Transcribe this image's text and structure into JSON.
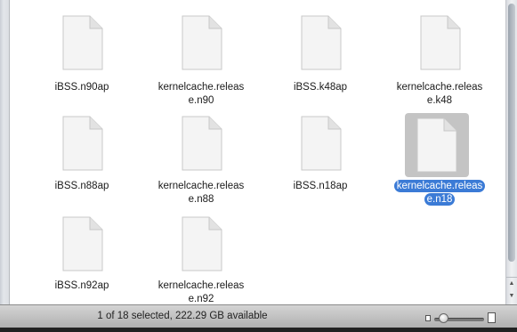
{
  "files": [
    {
      "name": "iBSS.n90ap",
      "selected": false
    },
    {
      "name": "kernelcache.releas\ne.n90",
      "selected": false
    },
    {
      "name": "iBSS.k48ap",
      "selected": false
    },
    {
      "name": "kernelcache.releas\ne.k48",
      "selected": false
    },
    {
      "name": "iBSS.n88ap",
      "selected": false
    },
    {
      "name": "kernelcache.releas\ne.n88",
      "selected": false
    },
    {
      "name": "iBSS.n18ap",
      "selected": false
    },
    {
      "name": "kernelcache.releas\ne.n18",
      "selected": true
    },
    {
      "name": "iBSS.n92ap",
      "selected": false
    },
    {
      "name": "kernelcache.releas\ne.n92",
      "selected": false
    }
  ],
  "status": {
    "text": "1 of 18 selected, 222.29 GB available"
  },
  "zoom": {
    "level": 0.1
  },
  "icons": {
    "file": "document-icon",
    "zoom_small": "small-icon-size-icon",
    "zoom_large": "large-icon-size-icon"
  },
  "colors": {
    "selection": "#3b7bd6",
    "icon_highlight": "#c4c4c4"
  }
}
